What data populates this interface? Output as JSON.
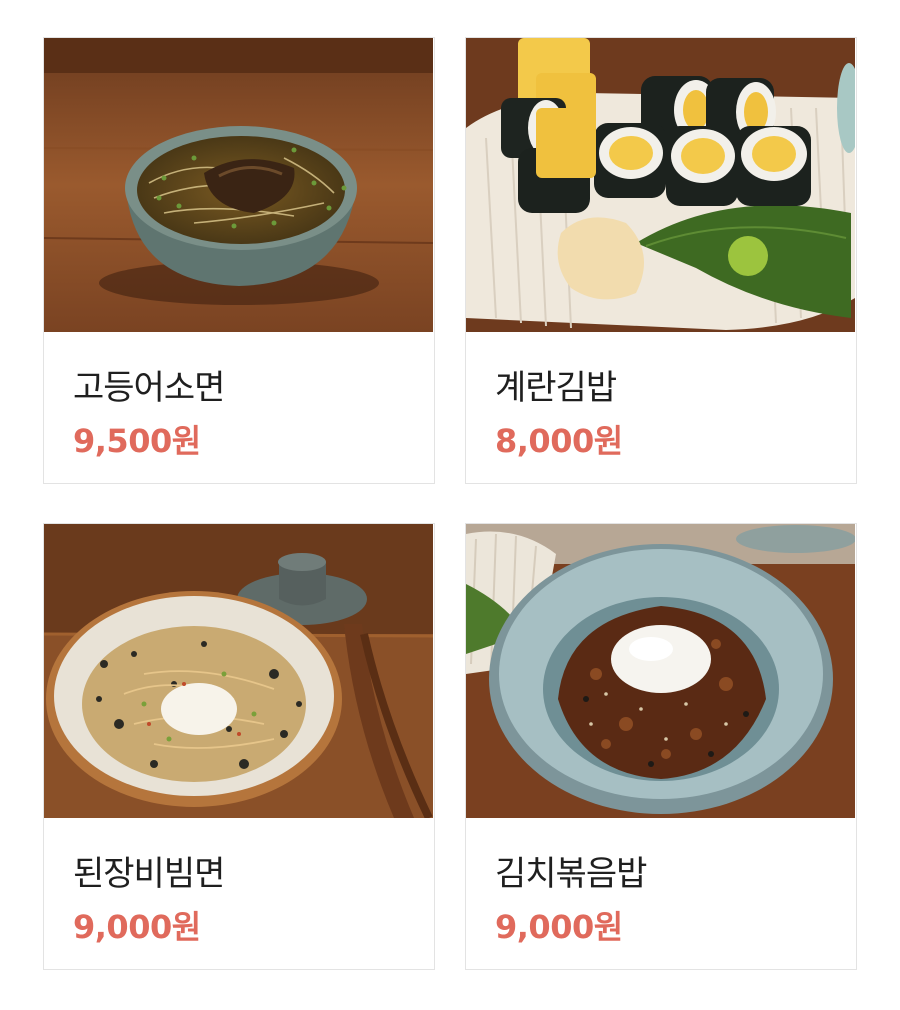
{
  "menu": {
    "items": [
      {
        "name": "고등어소면",
        "price": "9,500원",
        "photo": "mackerel-somen-photo"
      },
      {
        "name": "계란김밥",
        "price": "8,000원",
        "photo": "egg-gimbap-photo"
      },
      {
        "name": "된장비빔면",
        "price": "9,000원",
        "photo": "doenjang-bibim-noodle-photo"
      },
      {
        "name": "김치볶음밥",
        "price": "9,000원",
        "photo": "kimchi-fried-rice-photo"
      }
    ]
  },
  "colors": {
    "price": "#e06a5c",
    "name": "#1f1f1f",
    "border": "#e3e3e3"
  }
}
